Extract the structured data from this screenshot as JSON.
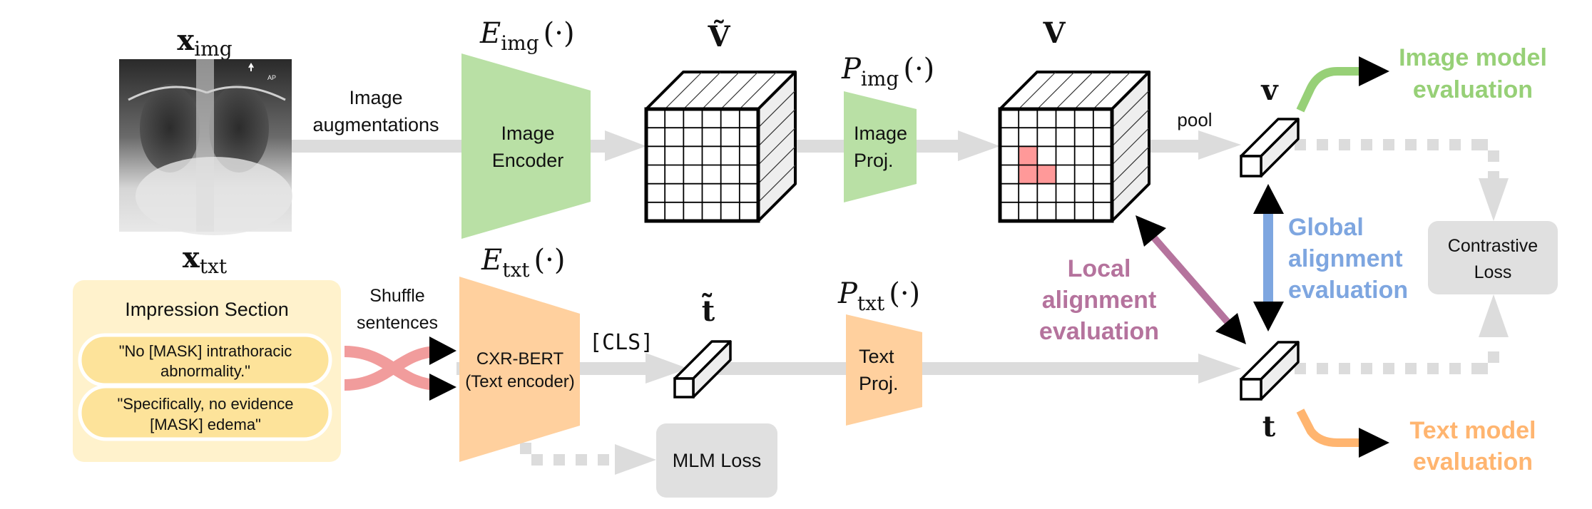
{
  "colors": {
    "image_green": "#b9e0a5",
    "text_orange": "#ffd09e",
    "arrow_gray": "#dcdcdc",
    "loss_box_gray": "#e0e0e0",
    "impression_bg": "#fff2cc",
    "sentence_pill": "#fde39a",
    "shuffle_pink": "#f19c9c",
    "highlight_cell": "#ff9999",
    "image_eval_green": "#97d077",
    "text_eval_orange": "#ffb570",
    "global_blue": "#7ea6e0",
    "local_purple": "#b5739d",
    "cube_side": "#eeeeee"
  },
  "image_branch": {
    "input_label": {
      "base": "x",
      "sub": "img"
    },
    "xray_marker": "AP",
    "augment_label": [
      "Image",
      "augmentations"
    ],
    "encoder_math": {
      "base": "E",
      "sub": "img",
      "arg": "(·)"
    },
    "encoder_label": [
      "Image",
      "Encoder"
    ],
    "feature_tilde_label": "Ṽ",
    "proj_math": {
      "base": "P",
      "sub": "img",
      "arg": "(·)"
    },
    "proj_label": [
      "Image",
      "Proj."
    ],
    "feature_label": "V",
    "grid_size": 6,
    "highlighted_cells": [
      [
        2,
        1
      ],
      [
        3,
        1
      ],
      [
        3,
        2
      ]
    ],
    "pool_label": "pool",
    "vector_label": "v"
  },
  "text_branch": {
    "input_label": {
      "base": "x",
      "sub": "txt"
    },
    "impression_title": "Impression Section",
    "sentences": [
      [
        "\"No [MASK] intrathoracic",
        "abnormality.\""
      ],
      [
        "\"Specifically, no evidence",
        "[MASK] edema\""
      ]
    ],
    "shuffle_label": [
      "Shuffle",
      "sentences"
    ],
    "encoder_math": {
      "base": "E",
      "sub": "txt",
      "arg": "(·)"
    },
    "encoder_label": [
      "CXR-BERT",
      "(Text encoder)"
    ],
    "cls_token": "[CLS]",
    "tilde_vector_label": "t̃",
    "proj_math": {
      "base": "P",
      "sub": "txt",
      "arg": "(·)"
    },
    "proj_label": [
      "Text",
      "Proj."
    ],
    "vector_label": "t",
    "mlm_loss": "MLM Loss"
  },
  "evaluation": {
    "image_model": [
      "Image model",
      "evaluation"
    ],
    "text_model": [
      "Text model",
      "evaluation"
    ],
    "global_alignment": [
      "Global",
      "alignment",
      "evaluation"
    ],
    "local_alignment": [
      "Local",
      "alignment",
      "evaluation"
    ],
    "contrastive_loss": [
      "Contrastive",
      "Loss"
    ]
  }
}
